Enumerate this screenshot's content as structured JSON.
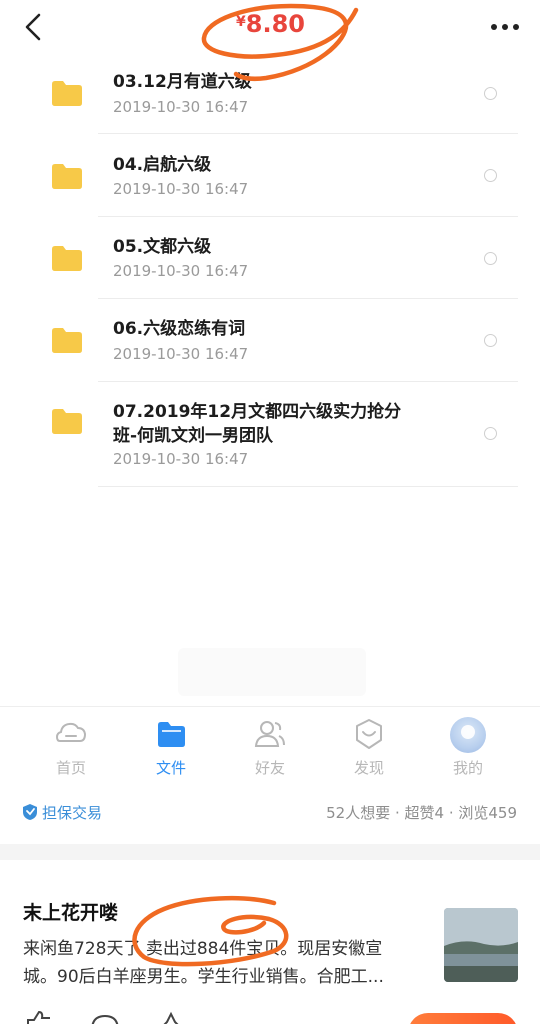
{
  "header": {
    "currency": "¥",
    "price": "8.80",
    "icons": [
      "back-icon",
      "more-icon"
    ]
  },
  "files": [
    {
      "name": "03.12月有道六级",
      "date": "2019-10-30  16:47"
    },
    {
      "name": "04.启航六级",
      "date": "2019-10-30  16:47"
    },
    {
      "name": "05.文都六级",
      "date": "2019-10-30  16:47"
    },
    {
      "name": "06.六级恋练有词",
      "date": "2019-10-30  16:47"
    },
    {
      "name": "07.2019年12月文都四六级实力抢分",
      "name2": "班-何凯文刘一男团队",
      "date": "2019-10-30  16:47"
    }
  ],
  "tabs": [
    {
      "label": "首页",
      "icon": "home-icon"
    },
    {
      "label": "文件",
      "icon": "folder-icon"
    },
    {
      "label": "好友",
      "icon": "friends-icon"
    },
    {
      "label": "发现",
      "icon": "discover-icon"
    },
    {
      "label": "我的",
      "icon": "profile-avatar"
    }
  ],
  "active_tab": "文件",
  "guarantee": {
    "label": "担保交易",
    "icon": "shield-icon"
  },
  "stats": "52人想要 · 超赞4 · 浏览459",
  "seller": {
    "name": "末上花开喽",
    "desc_line1": "来闲鱼728天了 卖出过884件宝贝。现居安徽宣",
    "desc_line2": "城。90后白羊座男生。学生行业销售。合肥工..."
  },
  "colors": {
    "price_red": "#e8453c",
    "annotation_orange": "#f06a22",
    "tab_active_blue": "#2e8ef2",
    "folder_yellow": "#f7c948",
    "guarantee_blue": "#3a8ed8"
  }
}
